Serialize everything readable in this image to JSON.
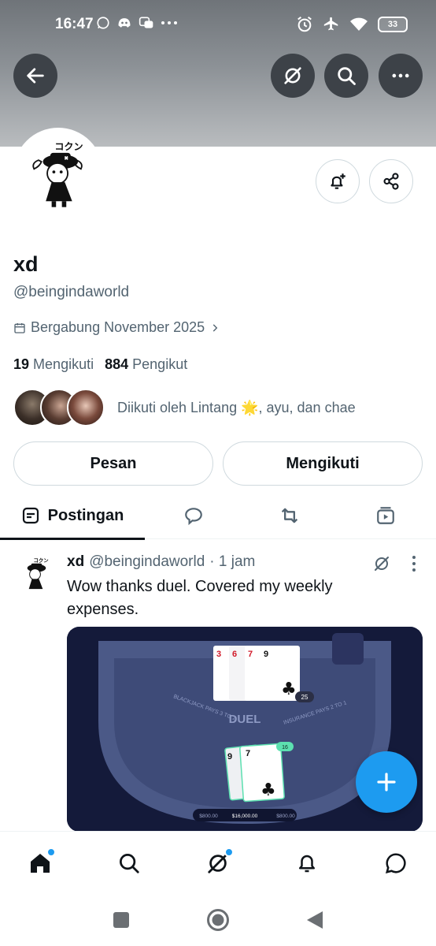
{
  "status_bar": {
    "time": "16:47",
    "battery": "33"
  },
  "profile": {
    "name": "xd",
    "handle": "@beingindaworld",
    "joined": "Bergabung November 2025",
    "following_count": "19",
    "following_label": "Mengikuti",
    "followers_count": "884",
    "followers_label": "Pengikut",
    "followed_by": "Diikuti oleh Lintang 🌟, ayu, dan chae"
  },
  "actions": {
    "message_label": "Pesan",
    "follow_label": "Mengikuti"
  },
  "tabs": [
    {
      "label": "Postingan"
    }
  ],
  "post": {
    "name": "xd",
    "handle": "@beingindaworld",
    "time": "· 1 jam",
    "text": "Wow thanks duel. Covered my weekly expenses."
  },
  "media": {
    "top_cards": [
      "3",
      "6",
      "7",
      "9"
    ],
    "top_total": "25",
    "bottom_cards": [
      "9",
      "7"
    ],
    "bottom_total": "16",
    "table_left": "BLACKJACK PAYS 3 TO 2",
    "table_center": "DUEL",
    "table_right": "INSURANCE PAYS 2 TO 1",
    "bet_left": "$800.00",
    "bet_main": "$16,000.00",
    "bet_right": "$800.00"
  },
  "colors": {
    "accent": "#1d9bf0",
    "text": "#0f1419",
    "secondary": "#536471"
  }
}
